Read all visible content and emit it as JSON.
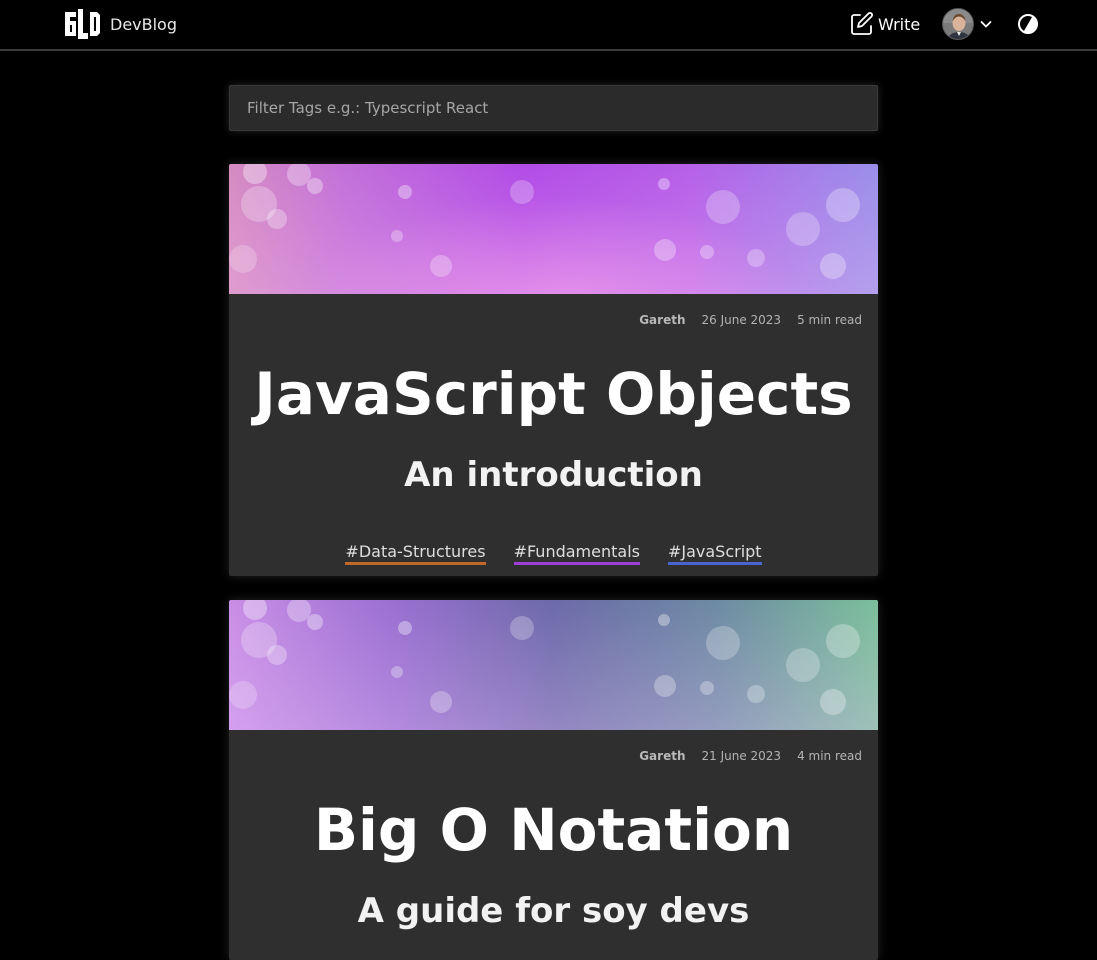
{
  "header": {
    "brand_name": "DevBlog",
    "write_label": "Write"
  },
  "filter": {
    "placeholder": "Filter Tags e.g.: Typescript React"
  },
  "posts": [
    {
      "author": "Gareth",
      "date": "26 June 2023",
      "read_time": "5 min read",
      "title": "JavaScript Objects",
      "subtitle": "An introduction",
      "tags": [
        {
          "label": "#Data-Structures",
          "color": "#c0692a"
        },
        {
          "label": "#Fundamentals",
          "color": "#9b3fd6"
        },
        {
          "label": "#JavaScript",
          "color": "#4b63d1"
        }
      ]
    },
    {
      "author": "Gareth",
      "date": "21 June 2023",
      "read_time": "4 min read",
      "title": "Big O Notation",
      "subtitle": "A guide for soy devs",
      "tags": []
    }
  ],
  "colors": {
    "background": "#000000",
    "card": "#2f2f2f",
    "header_border": "#3b3b3b"
  }
}
